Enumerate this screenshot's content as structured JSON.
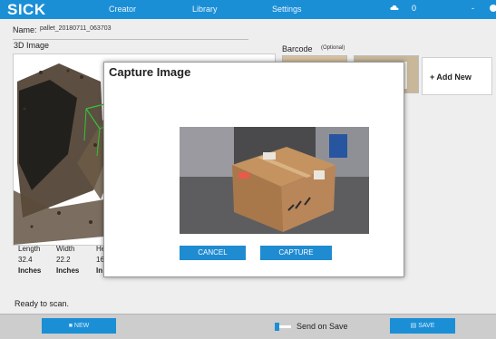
{
  "header": {
    "logo": "SICK",
    "nav": [
      "Creator",
      "Library",
      "Settings"
    ],
    "count": "0",
    "minimize": "-"
  },
  "form": {
    "name_label": "Name:",
    "name_value": "pallet_20180711_063703",
    "image3d_label": "3D Image",
    "barcode_label": "Barcode",
    "barcode_optional": "(Optional)",
    "add_new": "+ Add New"
  },
  "dimensions": [
    {
      "header": "Length",
      "value": "32.4",
      "unit": "Inches"
    },
    {
      "header": "Width",
      "value": "22.2",
      "unit": "Inches"
    },
    {
      "header": "He",
      "value": "16",
      "unit": "In"
    }
  ],
  "status": "Ready to scan.",
  "bottom": {
    "new_label": "NEW",
    "send_on_save": "Send on Save",
    "save_label": "SAVE",
    "send_on_save_enabled": 1
  },
  "modal": {
    "title": "Capture Image",
    "cancel": "CANCEL",
    "capture": "CAPTURE"
  },
  "colors": {
    "accent": "#1b8fd6",
    "background": "#eeeeee",
    "bottombar": "#cdcdcd"
  },
  "icons": [
    "cloud-icon",
    "info-icon",
    "plus-square-icon",
    "floppy-disk-icon"
  ]
}
